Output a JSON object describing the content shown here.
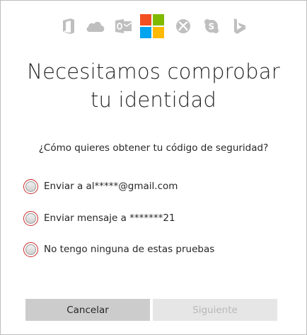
{
  "header": {
    "icons": [
      "office-icon",
      "onedrive-icon",
      "outlook-icon",
      "microsoft-logo",
      "xbox-icon",
      "skype-icon",
      "bing-icon"
    ]
  },
  "colors": {
    "icon_gray": "#bfbfbf",
    "ms_red": "#f25022",
    "ms_green": "#7fba00",
    "ms_blue": "#00a4ef",
    "ms_yellow": "#ffb900",
    "highlight_red": "#cc2a2a"
  },
  "title": {
    "line1": "Necesitamos comprobar",
    "line2": "tu identidad"
  },
  "question": "¿Cómo quieres obtener tu código de seguridad?",
  "options": [
    {
      "label": "Enviar a al*****@gmail.com",
      "selected": false
    },
    {
      "label": "Enviar mensaje a *******21",
      "selected": false
    },
    {
      "label": "No tengo ninguna de estas pruebas",
      "selected": false
    }
  ],
  "buttons": {
    "cancel": "Cancelar",
    "next": "Siguiente"
  }
}
